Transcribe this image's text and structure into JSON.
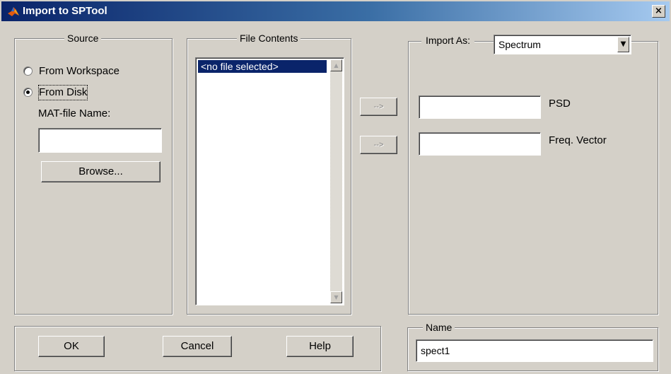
{
  "window": {
    "title": "Import to SPTool",
    "close_glyph": "×",
    "icon": "matlab-logo-icon"
  },
  "source": {
    "legend": "Source",
    "radio_workspace": "From Workspace",
    "radio_disk": "From Disk",
    "selected": "From Disk",
    "matfile_label": "MAT-file Name:",
    "matfile_value": "",
    "browse_label": "Browse..."
  },
  "file_contents": {
    "legend": "File Contents",
    "items": [
      "<no file selected>"
    ],
    "scroll_up_glyph": "▲",
    "scroll_down_glyph": "▼"
  },
  "arrows": {
    "psd_arrow": "-->",
    "freq_arrow": "-->"
  },
  "import_as": {
    "label": "Import As:",
    "selected": "Spectrum",
    "dropdown_glyph": "▼",
    "psd_label": "PSD",
    "psd_value": "",
    "freq_label": "Freq. Vector",
    "freq_value": ""
  },
  "buttons": {
    "ok": "OK",
    "cancel": "Cancel",
    "help": "Help"
  },
  "name": {
    "legend": "Name",
    "value": "spect1"
  }
}
